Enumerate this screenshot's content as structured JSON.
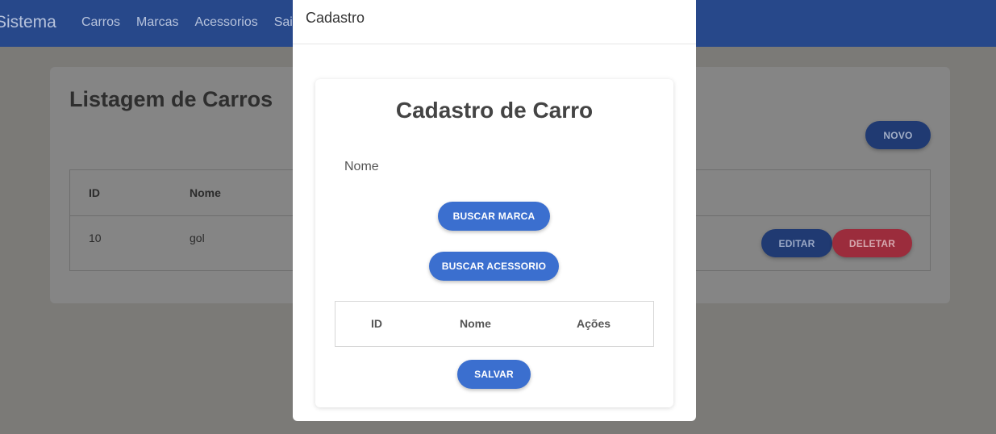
{
  "navbar": {
    "brand": "Sistema",
    "items": [
      "Carros",
      "Marcas",
      "Acessorios",
      "Sai"
    ]
  },
  "listing": {
    "title": "Listagem de Carros",
    "novo_label": "NOVO",
    "table": {
      "headers": [
        "ID",
        "Nome"
      ],
      "rows": [
        {
          "id": "10",
          "nome": "gol"
        }
      ]
    },
    "editar_label": "EDITAR",
    "deletar_label": "DELETAR"
  },
  "modal": {
    "title": "Cadastro",
    "form_title": "Cadastro de Carro",
    "nome_label": "Nome",
    "buscar_marca_label": "BUSCAR MARCA",
    "buscar_acessorio_label": "BUSCAR ACESSORIO",
    "table_headers": [
      "ID",
      "Nome",
      "Ações"
    ],
    "salvar_label": "SALVAR"
  },
  "colors": {
    "primary": "#3b6fcf",
    "danger": "#dc3545",
    "navbar": "#3a6bd0"
  }
}
